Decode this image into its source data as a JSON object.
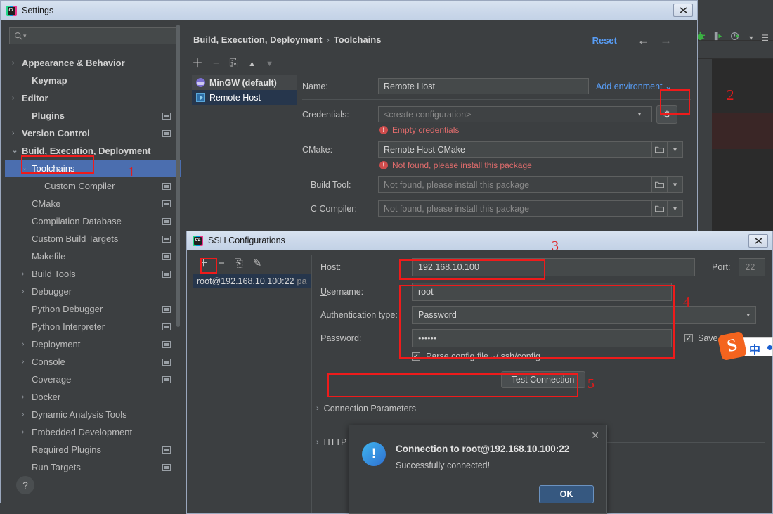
{
  "ide": {
    "mark_number": "2",
    "toolbar_icons": [
      "debug-bug-icon",
      "run-with-coverage-icon",
      "profile-icon",
      "chevron-down-icon",
      "menu-icon"
    ]
  },
  "settings_window": {
    "title": "Settings",
    "close_label": "✕",
    "search": {
      "placeholder": "",
      "value": "Q▾"
    },
    "tree": [
      {
        "label": "Appearance & Behavior",
        "arrow": "›",
        "bold": true,
        "indent": 1,
        "badge": false,
        "selected": false
      },
      {
        "label": "Keymap",
        "arrow": "",
        "bold": true,
        "indent": 2,
        "badge": false,
        "selected": false
      },
      {
        "label": "Editor",
        "arrow": "›",
        "bold": true,
        "indent": 1,
        "badge": false,
        "selected": false
      },
      {
        "label": "Plugins",
        "arrow": "",
        "bold": true,
        "indent": 2,
        "badge": true,
        "selected": false
      },
      {
        "label": "Version Control",
        "arrow": "›",
        "bold": true,
        "indent": 1,
        "badge": true,
        "selected": false
      },
      {
        "label": "Build, Execution, Deployment",
        "arrow": "⌄",
        "bold": true,
        "indent": 1,
        "badge": false,
        "selected": false
      },
      {
        "label": "Toolchains",
        "arrow": "⌄",
        "bold": false,
        "indent": 2,
        "badge": false,
        "selected": true
      },
      {
        "label": "Custom Compiler",
        "arrow": "",
        "bold": false,
        "indent": 3,
        "badge": true,
        "selected": false
      },
      {
        "label": "CMake",
        "arrow": "",
        "bold": false,
        "indent": 2,
        "badge": true,
        "selected": false
      },
      {
        "label": "Compilation Database",
        "arrow": "",
        "bold": false,
        "indent": 2,
        "badge": true,
        "selected": false
      },
      {
        "label": "Custom Build Targets",
        "arrow": "",
        "bold": false,
        "indent": 2,
        "badge": true,
        "selected": false
      },
      {
        "label": "Makefile",
        "arrow": "",
        "bold": false,
        "indent": 2,
        "badge": true,
        "selected": false
      },
      {
        "label": "Build Tools",
        "arrow": "›",
        "bold": false,
        "indent": 2,
        "badge": true,
        "selected": false
      },
      {
        "label": "Debugger",
        "arrow": "›",
        "bold": false,
        "indent": 2,
        "badge": false,
        "selected": false
      },
      {
        "label": "Python Debugger",
        "arrow": "",
        "bold": false,
        "indent": 2,
        "badge": true,
        "selected": false
      },
      {
        "label": "Python Interpreter",
        "arrow": "",
        "bold": false,
        "indent": 2,
        "badge": true,
        "selected": false
      },
      {
        "label": "Deployment",
        "arrow": "›",
        "bold": false,
        "indent": 2,
        "badge": true,
        "selected": false
      },
      {
        "label": "Console",
        "arrow": "›",
        "bold": false,
        "indent": 2,
        "badge": true,
        "selected": false
      },
      {
        "label": "Coverage",
        "arrow": "",
        "bold": false,
        "indent": 2,
        "badge": true,
        "selected": false
      },
      {
        "label": "Docker",
        "arrow": "›",
        "bold": false,
        "indent": 2,
        "badge": false,
        "selected": false
      },
      {
        "label": "Dynamic Analysis Tools",
        "arrow": "›",
        "bold": false,
        "indent": 2,
        "badge": false,
        "selected": false
      },
      {
        "label": "Embedded Development",
        "arrow": "›",
        "bold": false,
        "indent": 2,
        "badge": false,
        "selected": false
      },
      {
        "label": "Required Plugins",
        "arrow": "",
        "bold": false,
        "indent": 2,
        "badge": true,
        "selected": false
      },
      {
        "label": "Run Targets",
        "arrow": "",
        "bold": false,
        "indent": 2,
        "badge": true,
        "selected": false
      }
    ],
    "help_label": "?",
    "breadcrumb": {
      "root": "Build, Execution, Deployment",
      "sep": "›",
      "leaf": "Toolchains"
    },
    "reset_label": "Reset",
    "nav_back": "←",
    "nav_forward": "→",
    "toolchain_toolbar": [
      "＋",
      "−",
      "⎘",
      "▲",
      "▼"
    ],
    "toolchains": [
      {
        "label": "MinGW (default)",
        "icon": "mingw-icon",
        "selected": false
      },
      {
        "label": "Remote Host",
        "icon": "remote-icon",
        "selected": true
      }
    ],
    "fields": {
      "name_label": "Name:",
      "name_value": "Remote Host",
      "add_environment": "Add environment",
      "add_environment_caret": "⌄",
      "credentials_label": "Credentials:",
      "credentials_value": "<create configuration>",
      "credentials_error": "Empty credentials",
      "gear_icon": "⚙",
      "cmake_label": "CMake:",
      "cmake_value": "Remote Host CMake",
      "cmake_error": "Not found, please install this package",
      "buildtool_label": "Build Tool:",
      "buildtool_value": "Not found, please install this package",
      "ccompiler_label": "C Compiler:",
      "ccompiler_value": "Not found, please install this package",
      "folder_icon": "📁",
      "dropdown_icon": "▾"
    }
  },
  "ssh_dialog": {
    "title": "SSH Configurations",
    "close_label": "✕",
    "toolbar": [
      "＋",
      "−",
      "⎘",
      "✎"
    ],
    "config_item": "root@192.168.10.100:22",
    "config_item_dim": "pa",
    "host_label": "Host:",
    "host_value": "192.168.10.100",
    "port_label": "Port:",
    "port_value": "22",
    "username_label": "Username:",
    "username_value": "root",
    "auth_label": "Authentication type:",
    "auth_value": "Password",
    "password_label": "Password:",
    "password_value": "••••••",
    "save_password_label": "Save pa",
    "parse_config_label": "Parse config file ~/.ssh/config",
    "test_connection_label": "Test Connection",
    "connection_parameters_label": "Connection Parameters",
    "http_label": "HTTP",
    "section_arrow": "›"
  },
  "popup": {
    "title": "Connection to root@192.168.10.100:22",
    "message": "Successfully connected!",
    "ok_label": "OK",
    "close_label": "✕",
    "icon": "!"
  },
  "annotations": [
    {
      "number": "1"
    },
    {
      "number": "2"
    },
    {
      "number": "3"
    },
    {
      "number": "4"
    },
    {
      "number": "5"
    }
  ],
  "ime": {
    "logo": "S",
    "mode": "中"
  },
  "colors": {
    "accent_blue": "#589df6",
    "selection_blue": "#4b6eaf",
    "error_red": "#e06c6c",
    "annotation_red": "#ef1b1b",
    "panel_bg": "#3c3f41",
    "input_bg": "#45494a"
  }
}
